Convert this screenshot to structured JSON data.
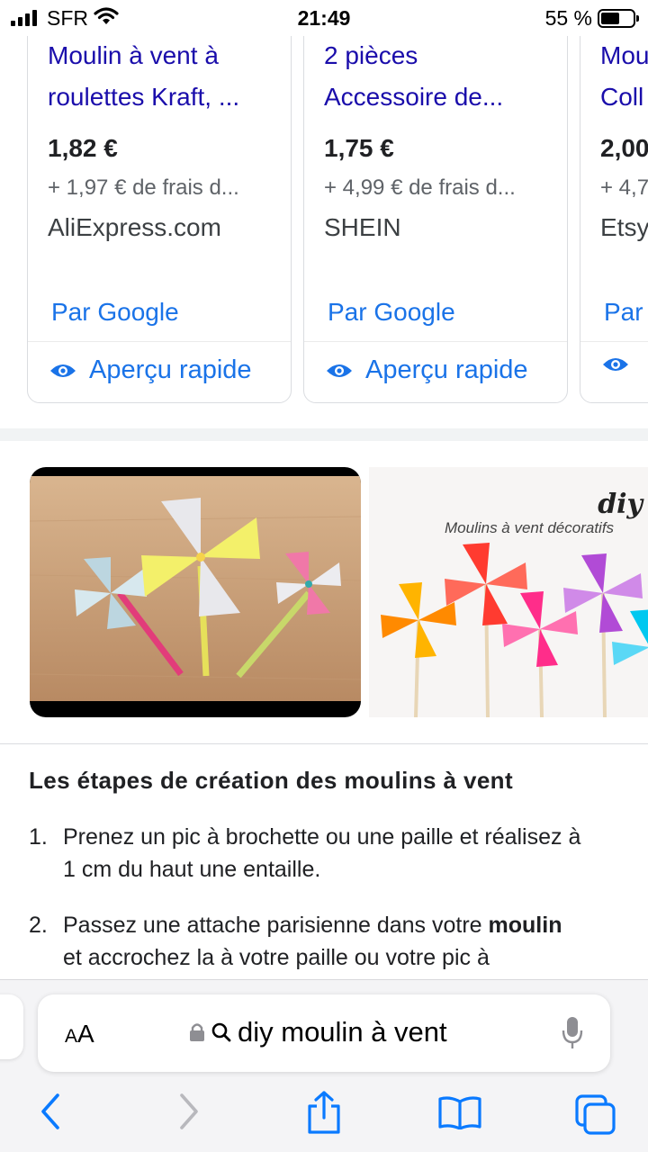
{
  "status_bar": {
    "carrier": "SFR",
    "time": "21:49",
    "battery": "55 %",
    "battery_level": 0.55
  },
  "products": [
    {
      "title_line1": "Moulin à vent à",
      "title_line2": "roulettes Kraft, ...",
      "price": "1,82 €",
      "shipping": "+ 1,97 € de frais d...",
      "store": "AliExpress.com",
      "by": "Par Google",
      "quick_view": "Aperçu rapide"
    },
    {
      "title_line1": "2 pièces",
      "title_line2": "Accessoire de...",
      "price": "1,75 €",
      "shipping": "+ 4,99 € de frais d...",
      "store": "SHEIN",
      "by": "Par Google",
      "quick_view": "Aperçu rapide"
    },
    {
      "title_line1": "Mou",
      "title_line2": "Coll",
      "price": "2,00",
      "shipping": "+ 4,7",
      "store": "Etsy",
      "by": "Par",
      "quick_view": ""
    }
  ],
  "images": {
    "second_brand": "diy",
    "second_caption": "Moulins à vent décoratifs"
  },
  "article": {
    "heading": "Les étapes de création des moulins à vent",
    "steps": [
      {
        "number": "1.",
        "line1": "Prenez un pic à brochette ou une paille et réalisez à",
        "line2": "1 cm du haut une entaille."
      },
      {
        "number": "2.",
        "line1_before": "Passez une attache parisienne dans votre ",
        "line1_bold": "moulin",
        "line2": "et accrochez la à votre paille ou votre pic à"
      }
    ]
  },
  "browser": {
    "text_size_label_big": "A",
    "text_size_label_small": "A",
    "address": "diy moulin à vent"
  },
  "colors": {
    "link": "#1a0dab",
    "accent": "#1a73e8",
    "ios_blue": "#0a7aff"
  }
}
